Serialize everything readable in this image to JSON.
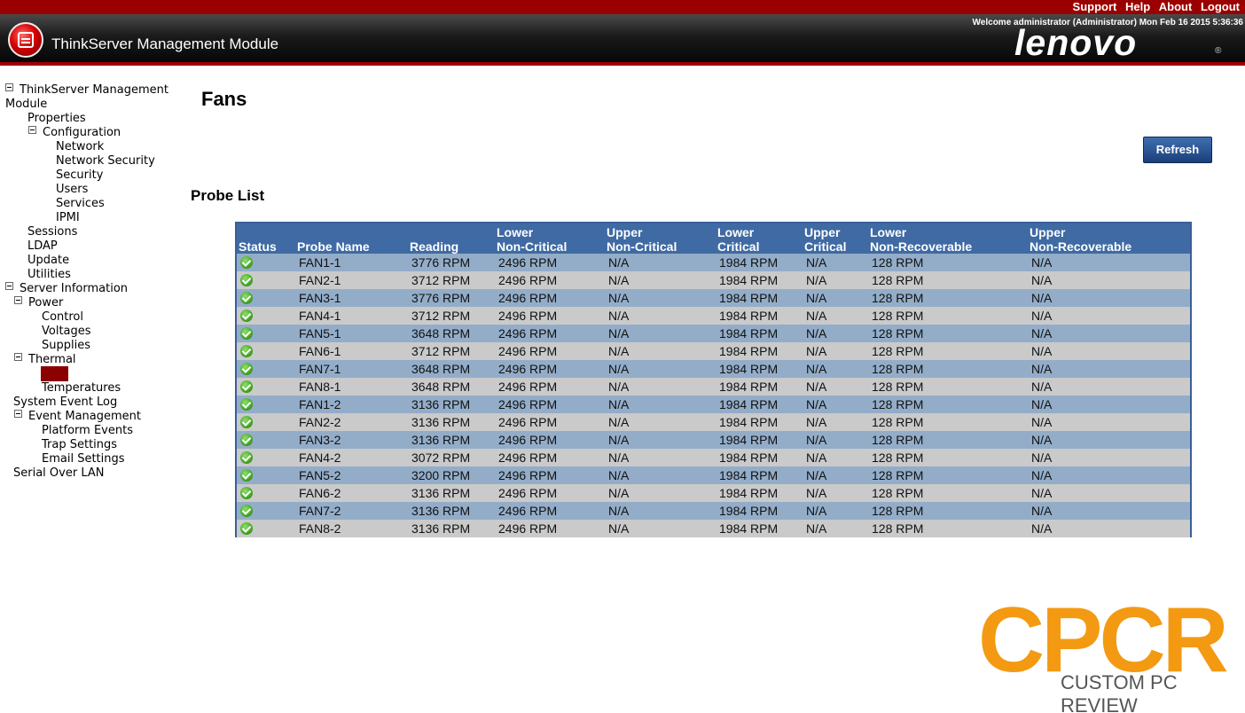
{
  "topbar": {
    "links": [
      "Support",
      "Help",
      "About",
      "Logout"
    ]
  },
  "header": {
    "app_title": "ThinkServer Management Module",
    "welcome": "Welcome administrator (Administrator) Mon Feb 16 2015 5:36:36",
    "brand": "lenovo",
    "brand_mark": "®"
  },
  "sidebar": {
    "nodes": [
      "ThinkServer Management",
      "Module",
      "Properties",
      "Configuration",
      "Network",
      "Network Security",
      "Security",
      "Users",
      "Services",
      "IPMI",
      "Sessions",
      "LDAP",
      "Update",
      "Utilities",
      "Server Information",
      "Power",
      "Control",
      "Voltages",
      "Supplies",
      "Thermal",
      "Fans",
      "Temperatures",
      "System Event Log",
      "Event Management",
      "Platform Events",
      "Trap Settings",
      "Email Settings",
      "Serial Over LAN"
    ]
  },
  "main": {
    "title": "Fans",
    "refresh_label": "Refresh",
    "section_title": "Probe List"
  },
  "table": {
    "headers": [
      [
        "",
        "Status"
      ],
      [
        "",
        "Probe Name"
      ],
      [
        "",
        "Reading"
      ],
      [
        "Lower",
        "Non-Critical"
      ],
      [
        "Upper",
        "Non-Critical"
      ],
      [
        "Lower",
        "Critical"
      ],
      [
        "Upper",
        "Critical"
      ],
      [
        "Lower",
        "Non-Recoverable"
      ],
      [
        "Upper",
        "Non-Recoverable"
      ]
    ],
    "status_icon": "ok-check-icon",
    "rows": [
      [
        "FAN1-1",
        "3776 RPM",
        "2496 RPM",
        "N/A",
        "1984 RPM",
        "N/A",
        "128 RPM",
        "N/A"
      ],
      [
        "FAN2-1",
        "3712 RPM",
        "2496 RPM",
        "N/A",
        "1984 RPM",
        "N/A",
        "128 RPM",
        "N/A"
      ],
      [
        "FAN3-1",
        "3776 RPM",
        "2496 RPM",
        "N/A",
        "1984 RPM",
        "N/A",
        "128 RPM",
        "N/A"
      ],
      [
        "FAN4-1",
        "3712 RPM",
        "2496 RPM",
        "N/A",
        "1984 RPM",
        "N/A",
        "128 RPM",
        "N/A"
      ],
      [
        "FAN5-1",
        "3648 RPM",
        "2496 RPM",
        "N/A",
        "1984 RPM",
        "N/A",
        "128 RPM",
        "N/A"
      ],
      [
        "FAN6-1",
        "3712 RPM",
        "2496 RPM",
        "N/A",
        "1984 RPM",
        "N/A",
        "128 RPM",
        "N/A"
      ],
      [
        "FAN7-1",
        "3648 RPM",
        "2496 RPM",
        "N/A",
        "1984 RPM",
        "N/A",
        "128 RPM",
        "N/A"
      ],
      [
        "FAN8-1",
        "3648 RPM",
        "2496 RPM",
        "N/A",
        "1984 RPM",
        "N/A",
        "128 RPM",
        "N/A"
      ],
      [
        "FAN1-2",
        "3136 RPM",
        "2496 RPM",
        "N/A",
        "1984 RPM",
        "N/A",
        "128 RPM",
        "N/A"
      ],
      [
        "FAN2-2",
        "3136 RPM",
        "2496 RPM",
        "N/A",
        "1984 RPM",
        "N/A",
        "128 RPM",
        "N/A"
      ],
      [
        "FAN3-2",
        "3136 RPM",
        "2496 RPM",
        "N/A",
        "1984 RPM",
        "N/A",
        "128 RPM",
        "N/A"
      ],
      [
        "FAN4-2",
        "3072 RPM",
        "2496 RPM",
        "N/A",
        "1984 RPM",
        "N/A",
        "128 RPM",
        "N/A"
      ],
      [
        "FAN5-2",
        "3200 RPM",
        "2496 RPM",
        "N/A",
        "1984 RPM",
        "N/A",
        "128 RPM",
        "N/A"
      ],
      [
        "FAN6-2",
        "3136 RPM",
        "2496 RPM",
        "N/A",
        "1984 RPM",
        "N/A",
        "128 RPM",
        "N/A"
      ],
      [
        "FAN7-2",
        "3136 RPM",
        "2496 RPM",
        "N/A",
        "1984 RPM",
        "N/A",
        "128 RPM",
        "N/A"
      ],
      [
        "FAN8-2",
        "3136 RPM",
        "2496 RPM",
        "N/A",
        "1984 RPM",
        "N/A",
        "128 RPM",
        "N/A"
      ]
    ]
  },
  "watermark": {
    "logo": "CPCR",
    "caption": "CUSTOM PC REVIEW"
  },
  "colors": {
    "top_bar": "#9a0000",
    "table_header": "#3f6aa3",
    "row_alt": "#93adc9",
    "row_base": "#cacaca",
    "watermark": "#f39a12"
  }
}
